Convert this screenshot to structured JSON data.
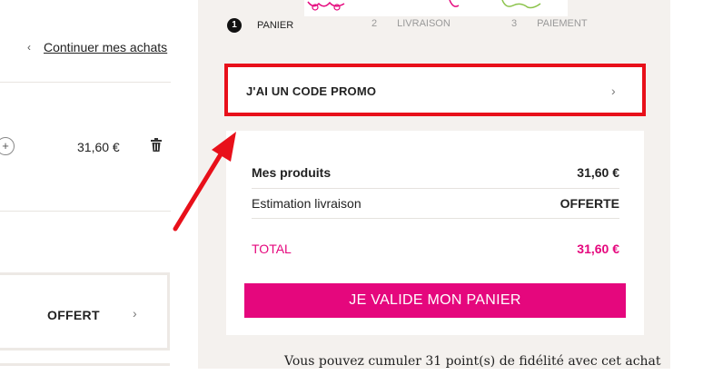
{
  "nav": {
    "continue_label": "Continuer mes achats"
  },
  "cart_item": {
    "price": "31,60 €"
  },
  "shipping": {
    "label": "OFFERT"
  },
  "steps": [
    {
      "num": "1",
      "label": "PANIER"
    },
    {
      "num": "2",
      "label": "LIVRAISON"
    },
    {
      "num": "3",
      "label": "PAIEMENT"
    }
  ],
  "promo": {
    "label": "J'AI UN CODE PROMO"
  },
  "summary": {
    "products_label": "Mes produits",
    "products_value": "31,60 €",
    "shipping_label": "Estimation livraison",
    "shipping_value": "OFFERTE",
    "total_label": "TOTAL",
    "total_value": "31,60 €"
  },
  "validate_label": "JE VALIDE MON PANIER",
  "loyalty_text": "Vous pouvez cumuler 31 point(s) de fidélité avec cet achat",
  "colors": {
    "accent": "#e5077d",
    "annotation": "#e8101a",
    "panel_bg": "#f4f1ee"
  },
  "icons": [
    "chevron-left-icon",
    "plus-circle-icon",
    "trash-icon",
    "chevron-right-icon",
    "annotation-arrow"
  ]
}
